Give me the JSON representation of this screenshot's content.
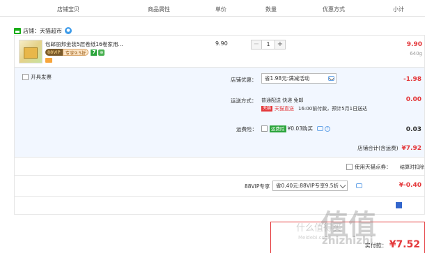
{
  "header": {
    "col_shop_item": "店铺宝贝",
    "col_attrs": "商品属性",
    "col_price": "单价",
    "col_qty": "数量",
    "col_discount": "优惠方式",
    "col_subtotal": "小计"
  },
  "shop": {
    "label": "店铺：天猫超市"
  },
  "item": {
    "title": "包邮丽邦金装5层卷纸16卷家用...",
    "vip_chip": "88VIP",
    "vip_discount": "专享9.5折",
    "badge_seven": "7",
    "unit_price": "9.90",
    "quantity": "1",
    "minus": "−",
    "plus": "+",
    "subtotal": "9.90",
    "weight": "640g"
  },
  "extras": {
    "invoice_label": "开具发票",
    "shop_discount_label": "店铺优惠：",
    "shop_discount_value": "省1.98元:满减活动",
    "shop_discount_amount": "-1.98",
    "shipping_label": "运送方式：",
    "shipping_line1": "普通配送 快递 免邮",
    "tmall_logo": "天猫",
    "tmall_text": "天猫直送",
    "shipping_promise": "16:00前付款，预计5月1日送达",
    "shipping_amount": "0.00",
    "insurance_label": "运费险：",
    "insurance_tag": "运费险",
    "insurance_price": "¥0.03购买",
    "insurance_amount": "0.03",
    "shop_total_label": "店铺合计(含运费)",
    "shop_total_value": "¥7.92"
  },
  "points": {
    "label": "使用天猫点券：",
    "right_text": "结算时扣除"
  },
  "vip": {
    "label": "88VIP专享",
    "select_value": "省0.40元:88VIP专享9.5折",
    "amount": "¥-0.40"
  },
  "summary": {
    "pay_label": "实付款：",
    "pay_value": "¥7.52"
  },
  "watermark": {
    "text1": "值",
    "text2": "什么值得买",
    "text3": "zhizhizhi",
    "text4": "Meidebi.com"
  },
  "colors": {
    "accent_red": "#e4393c",
    "tmall_green": "#2ca53c",
    "extras_bg": "#f2f7ff",
    "link_blue": "#6aa6e8"
  }
}
